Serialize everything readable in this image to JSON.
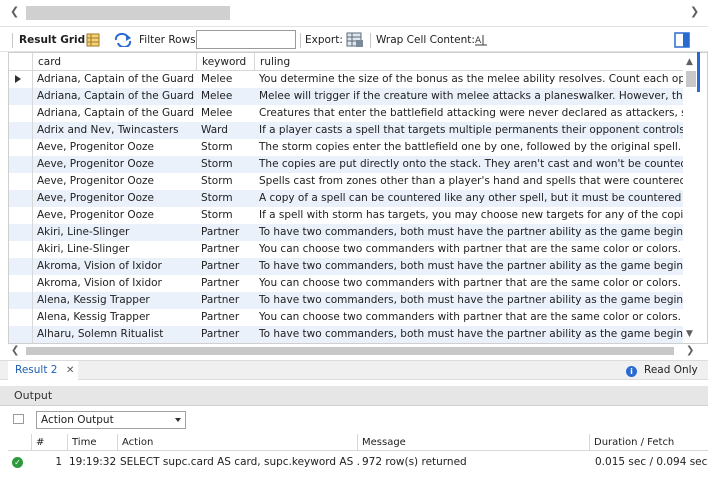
{
  "toolbar": {
    "result_grid_label": "Result Grid",
    "filter_rows_label": "Filter Rows:",
    "filter_rows_value": "",
    "export_label": "Export:",
    "wrap_cell_label": "Wrap Cell Content:"
  },
  "grid": {
    "columns": [
      "card",
      "keyword",
      "ruling"
    ],
    "rows": [
      [
        "Adriana, Captain of the Guard",
        "Melee",
        "You determine the size of the bonus as the melee ability resolves. Count each opponent"
      ],
      [
        "Adriana, Captain of the Guard",
        "Melee",
        "Melee will trigger if the creature with melee attacks a planeswalker. However, the effect"
      ],
      [
        "Adriana, Captain of the Guard",
        "Melee",
        "Creatures that enter the battlefield attacking were never declared as attackers, so they"
      ],
      [
        "Adrix and Nev, Twincasters",
        "Ward",
        "If a player casts a spell that targets multiple permanents their opponent controls with wa"
      ],
      [
        "Aeve, Progenitor Ooze",
        "Storm",
        "The storm copies enter the battlefield one by one, followed by the original spell. Each of"
      ],
      [
        "Aeve, Progenitor Ooze",
        "Storm",
        "The copies are put directly onto the stack. They aren't cast and won't be counted by oth"
      ],
      [
        "Aeve, Progenitor Ooze",
        "Storm",
        "Spells cast from zones other than a player's hand and spells that were countered or othe"
      ],
      [
        "Aeve, Progenitor Ooze",
        "Storm",
        "A copy of a spell can be countered like any other spell, but it must be countered individu"
      ],
      [
        "Aeve, Progenitor Ooze",
        "Storm",
        "If a spell with storm has targets, you may choose new targets for any of the copies. You"
      ],
      [
        "Akiri, Line-Slinger",
        "Partner",
        "To have two commanders, both must have the partner ability as the game begins. Losing"
      ],
      [
        "Akiri, Line-Slinger",
        "Partner",
        "You can choose two commanders with partner that are the same color or colors. In Comr"
      ],
      [
        "Akroma, Vision of Ixidor",
        "Partner",
        "To have two commanders, both must have the partner ability as the game begins. Losing"
      ],
      [
        "Akroma, Vision of Ixidor",
        "Partner",
        "You can choose two commanders with partner that are the same color or colors. In Comr"
      ],
      [
        "Alena, Kessig Trapper",
        "Partner",
        "To have two commanders, both must have the partner ability as the game begins. Losing"
      ],
      [
        "Alena, Kessig Trapper",
        "Partner",
        "You can choose two commanders with partner that are the same color or colors. In Comr"
      ],
      [
        "Alharu, Solemn Ritualist",
        "Partner",
        "To have two commanders, both must have the partner ability as the game begins. Losing"
      ]
    ]
  },
  "tabs": {
    "result_tab_label": "Result 2",
    "read_only_label": "Read Only"
  },
  "output": {
    "title": "Output",
    "selector_value": "Action Output",
    "columns": [
      "#",
      "Time",
      "Action",
      "Message",
      "Duration / Fetch"
    ],
    "row": {
      "num": "1",
      "time": "19:19:32",
      "action": "SELECT supc.card AS card, supc.keyword AS ...",
      "message": "972 row(s) returned",
      "duration": "0.015 sec / 0.094 sec"
    }
  },
  "colors": {
    "accent": "#2a6bd1",
    "alt_row": "#eaf1fb",
    "ok": "#2b9a3a"
  }
}
